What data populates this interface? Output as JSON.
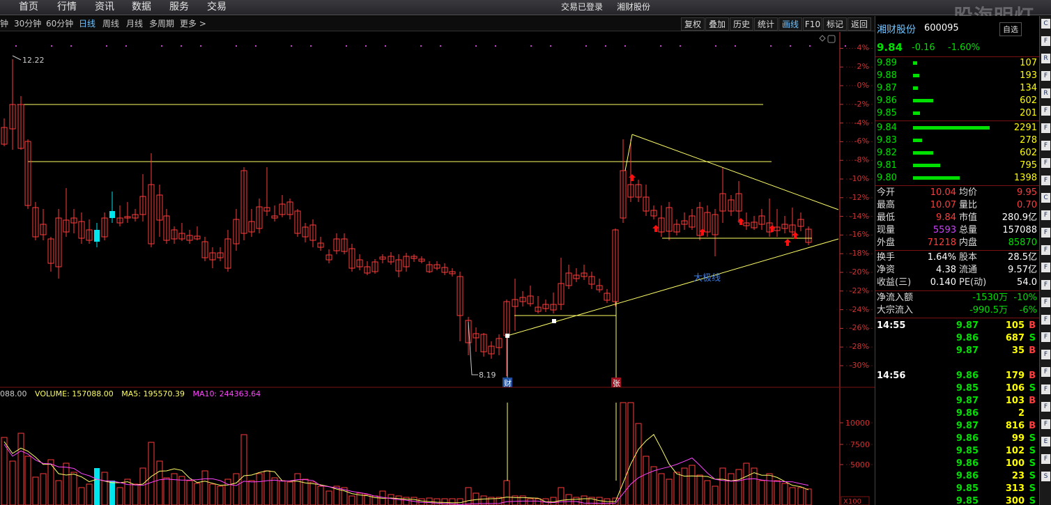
{
  "menu": {
    "items": [
      "首页",
      "行情",
      "资讯",
      "数据",
      "服务",
      "交易"
    ],
    "trade_status": "交易已登录",
    "account": "湘财股份"
  },
  "toolbar": {
    "periods": [
      "钟",
      "30分钟",
      "60分钟",
      "日线",
      "周线",
      "月线",
      "多周期",
      "更多 >"
    ],
    "active_period": "日线",
    "buttons": [
      "复权",
      "叠加",
      "历史",
      "统计",
      "画线",
      "F10",
      "标记",
      "返回"
    ],
    "active_button": "画线"
  },
  "chart": {
    "price_axis": {
      "labels": [
        "4%",
        "2%",
        "0%",
        "-2%",
        "-4%",
        "-6%",
        "-8%",
        "-10%",
        "-12%",
        "-14%",
        "-16%",
        "-18%",
        "-20%",
        "-22%",
        "-24%",
        "-26%",
        "-28%",
        "-30%"
      ]
    },
    "high_label": "12.22",
    "low_label": "8.19",
    "markers": {
      "cai": "财",
      "zhang": "张"
    },
    "drawing_label": "大极线",
    "colors": {
      "up": "#ff3c3c",
      "down": "#00e5ee",
      "line": "#ffff66",
      "ma5": "#ffff66",
      "ma10": "#ff44ff",
      "axis": "#cc3333",
      "grid": "#3a0000"
    }
  },
  "volume": {
    "prev_label": "088.00",
    "vol_label": "VOLUME: 157088.00",
    "ma5_label": "MA5: 195570.39",
    "ma10_label": "MA10: 244363.64",
    "axis": [
      "10000",
      "7500",
      "5000"
    ],
    "unit": "X100"
  },
  "quote": {
    "name": "湘财股份",
    "code": "600095",
    "price": "9.84",
    "change": "-0.16",
    "pct": "-1.60%",
    "asks": [
      {
        "p": "9.89",
        "v": "107",
        "w": 0.05
      },
      {
        "p": "9.88",
        "v": "193",
        "w": 0.08
      },
      {
        "p": "9.87",
        "v": "134",
        "w": 0.06
      },
      {
        "p": "9.86",
        "v": "602",
        "w": 0.26
      },
      {
        "p": "9.85",
        "v": "201",
        "w": 0.09
      }
    ],
    "bids": [
      {
        "p": "9.84",
        "v": "2291",
        "w": 1.0
      },
      {
        "p": "9.83",
        "v": "278",
        "w": 0.12
      },
      {
        "p": "9.82",
        "v": "602",
        "w": 0.26
      },
      {
        "p": "9.81",
        "v": "795",
        "w": 0.35
      },
      {
        "p": "9.80",
        "v": "1398",
        "w": 0.61
      }
    ],
    "stats": [
      {
        "l1": "今开",
        "v1": "10.04",
        "c1": "#ff3c3c",
        "l2": "均价",
        "v2": "9.95",
        "c2": "#ff3c3c"
      },
      {
        "l1": "最高",
        "v1": "10.07",
        "c1": "#ff3c3c",
        "l2": "量比",
        "v2": "0.70",
        "c2": "#ff3c3c"
      },
      {
        "l1": "最低",
        "v1": "9.84",
        "c1": "#ff3c3c",
        "l2": "市值",
        "v2": "280.9亿",
        "c2": "#fff"
      },
      {
        "l1": "现量",
        "v1": "5593",
        "c1": "#d040ff",
        "l2": "总量",
        "v2": "157088",
        "c2": "#fff"
      },
      {
        "l1": "外盘",
        "v1": "71218",
        "c1": "#ff3c3c",
        "l2": "内盘",
        "v2": "85870",
        "c2": "#00dd00"
      }
    ],
    "stats2": [
      {
        "l1": "换手",
        "v1": "1.64%",
        "c1": "#fff",
        "l2": "股本",
        "v2": "28.5亿",
        "c2": "#fff"
      },
      {
        "l1": "净资",
        "v1": "4.38",
        "c1": "#fff",
        "l2": "流通",
        "v2": "9.57亿",
        "c2": "#fff"
      },
      {
        "l1": "收益(三)",
        "v1": "0.140",
        "c1": "#fff",
        "l2": "PE(动)",
        "v2": "54.0",
        "c2": "#fff"
      }
    ],
    "flows": [
      {
        "l": "净流入额",
        "v": "-1530万",
        "p": "-10%"
      },
      {
        "l": "大宗流入",
        "v": "-990.5万",
        "p": "-6%"
      }
    ],
    "ticks": [
      {
        "t": "14:55",
        "p": "9.87",
        "v": "105",
        "s": "B"
      },
      {
        "t": "",
        "p": "9.86",
        "v": "687",
        "s": "S"
      },
      {
        "t": "",
        "p": "9.87",
        "v": "35",
        "s": "B"
      },
      {
        "t": "14:56",
        "p": "9.86",
        "v": "179",
        "s": "B"
      },
      {
        "t": "",
        "p": "9.85",
        "v": "106",
        "s": "S"
      },
      {
        "t": "",
        "p": "9.87",
        "v": "103",
        "s": "B"
      },
      {
        "t": "",
        "p": "9.86",
        "v": "2",
        "s": ""
      },
      {
        "t": "",
        "p": "9.87",
        "v": "816",
        "s": "B"
      },
      {
        "t": "",
        "p": "9.86",
        "v": "99",
        "s": "S"
      },
      {
        "t": "",
        "p": "9.85",
        "v": "102",
        "s": "S"
      },
      {
        "t": "",
        "p": "9.86",
        "v": "100",
        "s": "S"
      },
      {
        "t": "",
        "p": "9.86",
        "v": "23",
        "s": "S"
      },
      {
        "t": "",
        "p": "9.85",
        "v": "313",
        "s": "S"
      },
      {
        "t": "",
        "p": "9.85",
        "v": "300",
        "s": "S"
      }
    ],
    "selector_label": "自选"
  },
  "watermark": "股海明灯",
  "side_icons": [
    "C",
    "F",
    "R",
    "F",
    "R",
    "F",
    "F",
    "F",
    "F",
    "F",
    "C",
    "F",
    "F",
    "F",
    "F",
    "F",
    "F",
    "F",
    "F",
    "F",
    "F",
    "F",
    "F",
    "F",
    "E",
    "F",
    "S"
  ]
}
